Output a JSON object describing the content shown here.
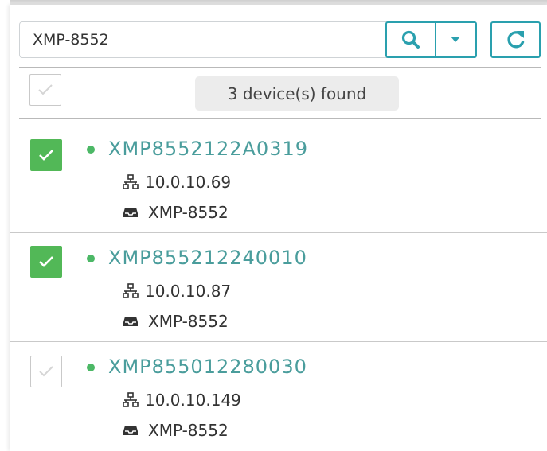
{
  "search": {
    "value": "XMP-8552"
  },
  "toolbar": {
    "search_icon": "search-icon",
    "dropdown_icon": "caret-down-icon",
    "refresh_icon": "refresh-icon",
    "accent_color": "#2aa0ae"
  },
  "summary": {
    "found_text": "3 device(s) found",
    "select_all_checked": false
  },
  "devices": [
    {
      "name": "XMP8552122A0319",
      "ip": "10.0.10.69",
      "model": "XMP-8552",
      "checked": true,
      "status": "online"
    },
    {
      "name": "XMP855212240010",
      "ip": "10.0.10.87",
      "model": "XMP-8552",
      "checked": true,
      "status": "online"
    },
    {
      "name": "XMP855012280030",
      "ip": "10.0.10.149",
      "model": "XMP-8552",
      "checked": false,
      "status": "online"
    }
  ],
  "colors": {
    "status_online": "#4cb866",
    "checkbox_checked": "#52b857",
    "device_name": "#4a9d9c"
  }
}
